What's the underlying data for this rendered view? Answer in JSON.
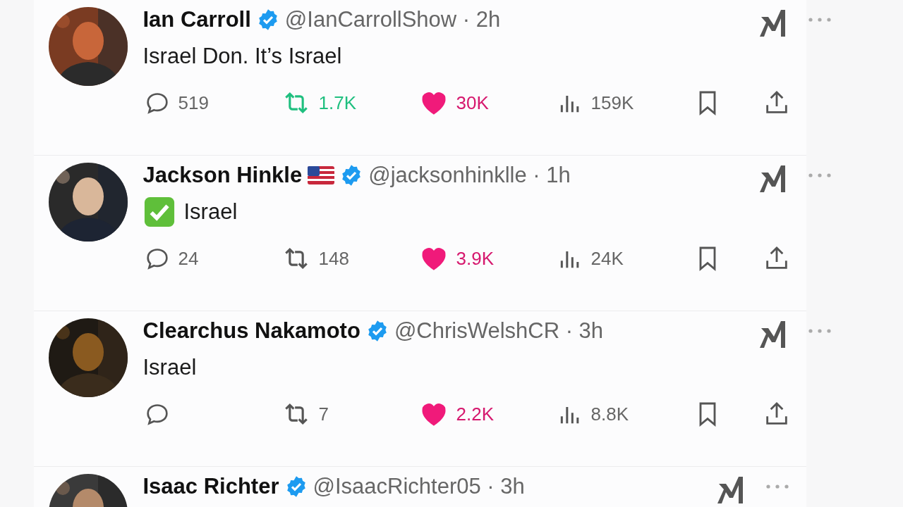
{
  "posts": [
    {
      "name": "Ian Carroll",
      "flag": false,
      "verified": true,
      "meta": "@IanCarrollShow · 2h",
      "check_emoji": false,
      "text": "Israel Don. It’s Israel",
      "replies": "519",
      "reposts": "1.7K",
      "reposted": true,
      "likes": "30K",
      "liked": true,
      "views": "159K"
    },
    {
      "name": "Jackson Hinkle",
      "flag": true,
      "verified": true,
      "meta": "@jacksonhinklle · 1h",
      "check_emoji": true,
      "text": "Israel",
      "replies": "24",
      "reposts": "148",
      "reposted": false,
      "likes": "3.9K",
      "liked": true,
      "views": "24K"
    },
    {
      "name": "Clearchus Nakamoto",
      "flag": false,
      "verified": true,
      "meta": "@ChrisWelshCR · 3h",
      "check_emoji": false,
      "text": "Israel",
      "reposts": "7",
      "reposted": false,
      "likes": "2.2K",
      "liked": true,
      "views": "8.8K"
    },
    {
      "name": "Isaac Richter",
      "flag": false,
      "verified": true,
      "meta": "@IsaacRichter05 · 3h"
    }
  ]
}
